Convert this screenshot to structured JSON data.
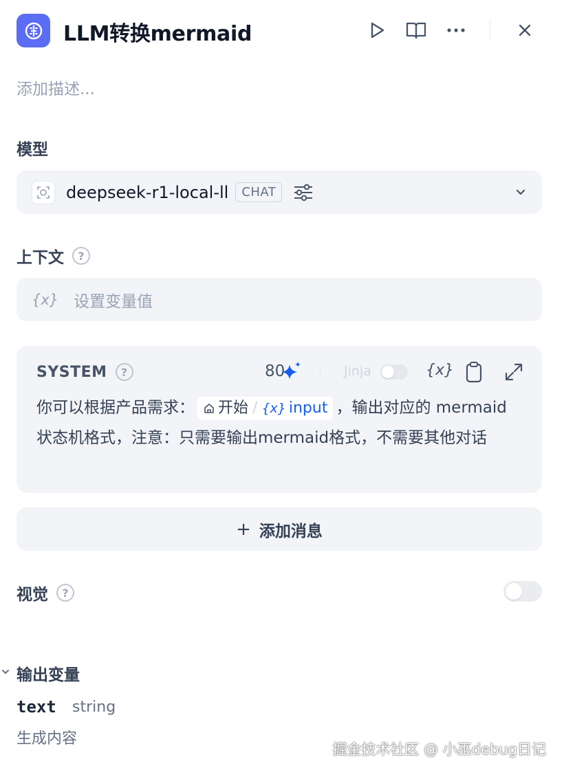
{
  "header": {
    "title": "LLM转换mermaid",
    "icon": "brain-node-icon",
    "accent_color": "#5b6cf5",
    "actions": [
      "run-icon",
      "book-icon",
      "more-icon",
      "close-icon"
    ]
  },
  "description_placeholder": "添加描述...",
  "model_section": {
    "label": "模型",
    "model_name": "deepseek-r1-local-ll",
    "mode_badge": "CHAT"
  },
  "context_section": {
    "label": "上下文",
    "var_symbol": "{x}",
    "placeholder": "设置变量值"
  },
  "system_prompt": {
    "label": "SYSTEM",
    "char_count": "80",
    "jinja_label": "Jinja",
    "jinja_enabled": false,
    "text_before": "你可以根据产品需求：",
    "chip_node": "开始",
    "chip_separator": "/",
    "chip_var_symbol": "{x}",
    "chip_var": "input",
    "text_after_chip": "，输出对应的 mermaid 状态机格式，注意：只需要输出mermaid格式，不需要其他对话"
  },
  "add_message": {
    "plus": "+",
    "label": "添加消息"
  },
  "vision_section": {
    "label": "视觉",
    "enabled": false
  },
  "output_section": {
    "title": "输出变量",
    "variable_name": "text",
    "variable_type": "string",
    "variable_description": "生成内容"
  },
  "watermark": "掘金技术社区 @ 小巫debug日记"
}
